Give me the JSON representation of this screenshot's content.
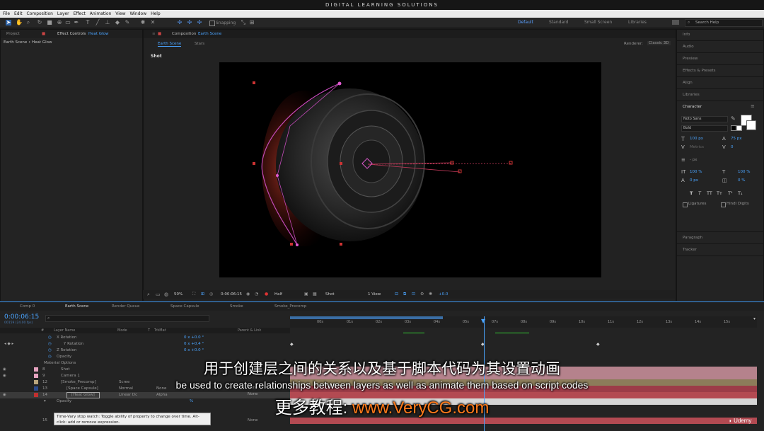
{
  "title": "DIGITAL LEARNING SOLUTIONS",
  "menu": [
    "File",
    "Edit",
    "Composition",
    "Layer",
    "Effect",
    "Animation",
    "View",
    "Window",
    "Help"
  ],
  "toolbar": {
    "snapping": "Snapping"
  },
  "workspaces": [
    "Default",
    "Standard",
    "Small Screen",
    "Libraries"
  ],
  "search_help": "Search Help",
  "left_panel": {
    "tabs": [
      "Project",
      "Effect Controls",
      "Heat Glow"
    ],
    "breadcrumb": "Earth Scene • Heat Glow"
  },
  "composition": {
    "tab_prefix": "Composition",
    "tab_name": "Earth Scene",
    "subtabs": [
      "Earth Scene",
      "Stars"
    ],
    "renderer_label": "Renderer:",
    "renderer_value": "Classic 3D",
    "shot_label": "Shot",
    "zoom": "50%",
    "timecode": "0:00:06:15",
    "resolution": "Half",
    "camera": "Shot",
    "view": "1 View",
    "exposure": "+0.0"
  },
  "right_panel": {
    "items_top": [
      "Info",
      "Audio",
      "Preview",
      "Effects & Presets",
      "Align",
      "Libraries"
    ],
    "character": {
      "title": "Character",
      "font": "Noto Sans",
      "style": "Bold",
      "size": "100 px",
      "leading": "75 px",
      "kerning": "Metrics",
      "tracking": "0",
      "stroke": "- px",
      "vscale": "100 %",
      "hscale": "100 %",
      "baseline": "0 px",
      "tsume": "0 %",
      "styles": [
        "T",
        "T",
        "TT",
        "Tт",
        "T¹",
        "T₁"
      ],
      "ligatures": "Ligatures",
      "hindi": "Hindi Digits"
    },
    "items_bottom": [
      "Paragraph",
      "Tracker"
    ]
  },
  "timeline": {
    "tabs": [
      "Comp 0",
      "Earth Scene",
      "Render Queue",
      "Space Capsule",
      "Smoke",
      "Smoke_Precomp"
    ],
    "timecode": "0:00:06:15",
    "fps": "00159 (24.00 fps)",
    "columns": [
      "#",
      "Layer Name",
      "Mode",
      "T",
      "TrkMat",
      "Parent & Link"
    ],
    "rows": [
      {
        "num": "",
        "name": "X Rotation",
        "value": "0 x +0.0 °"
      },
      {
        "num": "",
        "name": "Y Rotation",
        "value": "0 x +0.4 °"
      },
      {
        "num": "",
        "name": "Z Rotation",
        "value": "0 x +0.0 °"
      },
      {
        "num": "",
        "name": "Opacity",
        "value": ""
      },
      {
        "num": "",
        "name": "Material Options",
        "value": ""
      },
      {
        "num": "8",
        "name": "Shot",
        "value": ""
      },
      {
        "num": "9",
        "name": "Camera 1",
        "value": ""
      },
      {
        "num": "12",
        "name": "[Smoke_Precomp]",
        "mode": "Scree",
        "value": ""
      },
      {
        "num": "13",
        "name": "[Space Capsule]",
        "mode": "Normal",
        "trkmat": "None",
        "value": ""
      },
      {
        "num": "14",
        "name": "[Heat Glow]",
        "mode": "Linear Dc",
        "trkmat": "Alpha",
        "value": ""
      },
      {
        "num": "",
        "name": "Opacity",
        "value": "%"
      },
      {
        "num": "15",
        "name": "",
        "value": "None"
      }
    ],
    "parent_none": "None",
    "ticks": [
      "00s",
      "01s",
      "02s",
      "03s",
      "04s",
      "05s",
      "06s",
      "07s",
      "08s",
      "09s",
      "10s",
      "11s",
      "12s",
      "13s",
      "14s",
      "15s"
    ]
  },
  "tooltip": "Time-Vary stop watch: Toggle ability of property to change over time. Alt-click: add or remove expression.",
  "subtitles": {
    "cn": "用于创建层之间的关系以及基于脚本代码为其设置动画",
    "en": "be used to create relationships between layers as well as animate them based on script codes",
    "wm_prefix": "更多教程: ",
    "wm_url": "www.VeryCG.com"
  },
  "brand": "Udemy"
}
